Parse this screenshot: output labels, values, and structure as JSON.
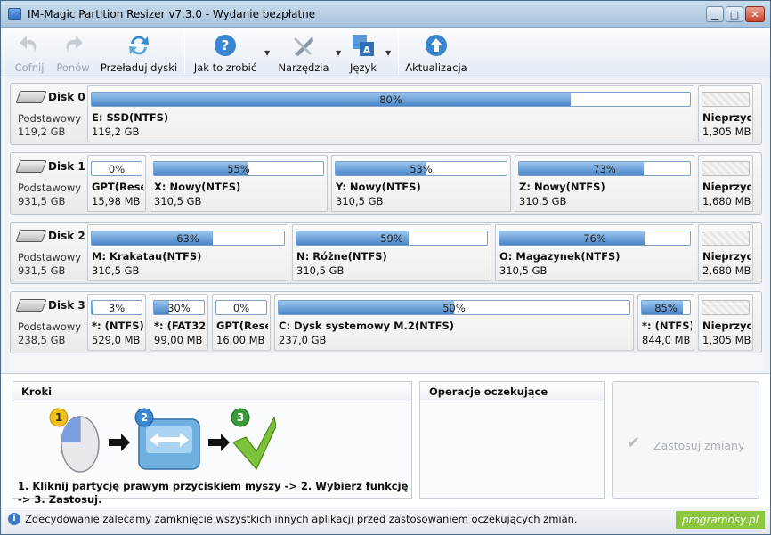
{
  "window": {
    "title": "IM-Magic Partition Resizer v7.3.0 - Wydanie bezpłatne",
    "min": "▁",
    "max": "□",
    "close": "✕"
  },
  "toolbar": {
    "undo": "Cofnij",
    "redo": "Ponów",
    "reload": "Przeładuj dyski",
    "howto": "Jak to zrobić",
    "tools": "Narzędzia",
    "language": "Język",
    "update": "Aktualizacja"
  },
  "disks": [
    {
      "name": "Disk 0",
      "type": "Podstawowy MBR",
      "size": "119,2 GB",
      "partitions": [
        {
          "pct": "80%",
          "fill": 0.8,
          "label": "E: SSD(NTFS)",
          "size": "119,2 GB"
        },
        {
          "pct": "",
          "fill": 0,
          "label": "Nieprzydzielone",
          "size": "1,305 MB",
          "unalloc": true
        }
      ]
    },
    {
      "name": "Disk 1",
      "type": "Podstawowy GPT",
      "size": "931,5 GB",
      "partitions": [
        {
          "pct": "0%",
          "fill": 0,
          "label": "GPT(Reserved)",
          "size": "15,98 MB"
        },
        {
          "pct": "55%",
          "fill": 0.55,
          "label": "X: Nowy(NTFS)",
          "size": "310,5 GB"
        },
        {
          "pct": "53%",
          "fill": 0.53,
          "label": "Y: Nowy(NTFS)",
          "size": "310,5 GB"
        },
        {
          "pct": "73%",
          "fill": 0.73,
          "label": "Z: Nowy(NTFS)",
          "size": "310,5 GB"
        },
        {
          "pct": "",
          "fill": 0,
          "label": "Nieprzydzielone",
          "size": "1,680 MB",
          "unalloc": true
        }
      ]
    },
    {
      "name": "Disk 2",
      "type": "Podstawowy MBR",
      "size": "931,5 GB",
      "partitions": [
        {
          "pct": "63%",
          "fill": 0.63,
          "label": "M: Krakatau(NTFS)",
          "size": "310,5 GB"
        },
        {
          "pct": "59%",
          "fill": 0.59,
          "label": "N: Różne(NTFS)",
          "size": "310,5 GB"
        },
        {
          "pct": "76%",
          "fill": 0.76,
          "label": "O: Magazynek(NTFS)",
          "size": "310,5 GB"
        },
        {
          "pct": "",
          "fill": 0,
          "label": "Nieprzydzielone",
          "size": "2,680 MB",
          "unalloc": true
        }
      ]
    },
    {
      "name": "Disk 3",
      "type": "Podstawowy GPT",
      "size": "238,5 GB",
      "partitions": [
        {
          "pct": "3%",
          "fill": 0.03,
          "label": "*: (NTFS)",
          "size": "529,0 MB"
        },
        {
          "pct": "30%",
          "fill": 0.3,
          "label": "*: (FAT32)",
          "size": "99,00 MB"
        },
        {
          "pct": "0%",
          "fill": 0,
          "label": "GPT(Reserved)",
          "size": "16,00 MB"
        },
        {
          "pct": "50%",
          "fill": 0.5,
          "label": "C: Dysk systemowy M.2(NTFS)",
          "size": "237,0 GB"
        },
        {
          "pct": "85%",
          "fill": 0.85,
          "label": "*: (NTFS)",
          "size": "844,0 MB"
        },
        {
          "pct": "",
          "fill": 0,
          "label": "Nieprzydzielone",
          "size": "1,305 MB",
          "unalloc": true
        }
      ]
    }
  ],
  "steps": {
    "title": "Kroki",
    "text": "1. Kliknij partycję prawym przyciskiem myszy -> 2. Wybierz funkcję -> 3. Zastosuj.",
    "n1": "1",
    "n2": "2",
    "n3": "3"
  },
  "pending": {
    "title": "Operacje oczekujące"
  },
  "apply": {
    "label": "Zastosuj zmiany"
  },
  "status": {
    "text": "Zdecydowanie zalecamy zamknięcie wszystkich innych aplikacji przed zastosowaniem oczekujących zmian.",
    "info": "i"
  },
  "watermark": "programosy.pl"
}
